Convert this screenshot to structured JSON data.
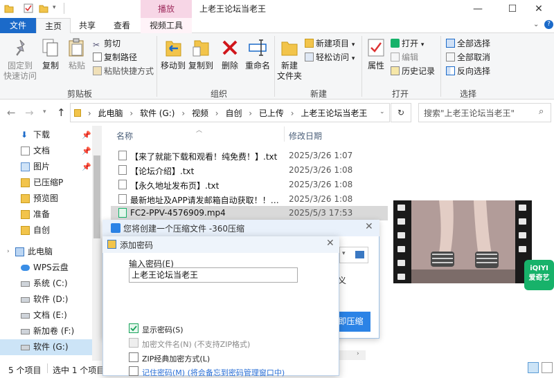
{
  "window": {
    "title": "上老王论坛当老王",
    "contextual_tab_group": "播放",
    "controls": {
      "minimize": "—",
      "maximize": "☐",
      "close": "✕"
    },
    "help": "?"
  },
  "ribbon_tabs": [
    "文件",
    "主页",
    "共享",
    "查看",
    "视频工具"
  ],
  "ribbon": {
    "clipboard": {
      "pin": "固定到\n快速访问",
      "pin_l1": "固定到",
      "pin_l2": "快速访问",
      "copy": "复制",
      "paste": "粘贴",
      "cut": "剪切",
      "copy_path": "复制路径",
      "paste_shortcut": "粘贴快捷方式",
      "label": "剪贴板"
    },
    "organize": {
      "move_to": "移动到",
      "copy_to": "复制到",
      "delete": "删除",
      "rename": "重命名",
      "label": "组织"
    },
    "new": {
      "new_folder_l1": "新建",
      "new_folder_l2": "文件夹",
      "new_item": "新建项目",
      "easy_access": "轻松访问",
      "label": "新建"
    },
    "open": {
      "properties": "属性",
      "open": "打开",
      "edit": "编辑",
      "history": "历史记录",
      "label": "打开"
    },
    "select": {
      "select_all": "全部选择",
      "select_none": "全部取消",
      "invert": "反向选择",
      "label": "选择"
    }
  },
  "address": {
    "crumbs": [
      "此电脑",
      "软件 (G:)",
      "视频",
      "自创",
      "已上传",
      "上老王论坛当老王"
    ],
    "search_placeholder": "搜索\"上老王论坛当老王\""
  },
  "sidebar": {
    "items": [
      {
        "label": "下载",
        "pinned": true
      },
      {
        "label": "文档",
        "pinned": true
      },
      {
        "label": "图片",
        "pinned": true
      },
      {
        "label": "已压缩P",
        "pinned": false
      },
      {
        "label": "预览图",
        "pinned": false
      },
      {
        "label": "准备",
        "pinned": false
      },
      {
        "label": "自创",
        "pinned": false
      },
      {
        "label": "此电脑",
        "pinned": false
      },
      {
        "label": "WPS云盘",
        "pinned": false
      },
      {
        "label": "系统 (C:)",
        "pinned": false
      },
      {
        "label": "软件 (D:)",
        "pinned": false
      },
      {
        "label": "文档 (E:)",
        "pinned": false
      },
      {
        "label": "新加卷 (F:)",
        "pinned": false
      },
      {
        "label": "软件 (G:)",
        "pinned": false
      }
    ]
  },
  "file_list": {
    "columns": {
      "name": "名称",
      "date": "修改日期"
    },
    "rows": [
      {
        "name": "【来了就能下载和观看！纯免费！】.txt",
        "date": "2025/3/26 1:07"
      },
      {
        "name": "【论坛介绍】.txt",
        "date": "2025/3/26 1:08"
      },
      {
        "name": "【永久地址发布页】.txt",
        "date": "2025/3/26 1:08"
      },
      {
        "name": "最新地址及APP请发邮箱自动获取！！！...",
        "date": "2025/3/26 1:08"
      },
      {
        "name": "FC2-PPV-4576909.mp4",
        "date": "2025/5/3 17:53"
      }
    ],
    "selected_index": 4
  },
  "preview": {
    "badge_l1": "iQIYI",
    "badge_l2": "爱奇艺"
  },
  "status": {
    "count": "5 个项目",
    "selected": "选中 1 个项目"
  },
  "dialog_360": {
    "title": "您将创建一个压缩文件 -360压缩",
    "partial_text": "义",
    "button": "即压缩"
  },
  "password_dialog": {
    "title": "添加密码",
    "input_label": "输入密码(E)",
    "input_value": "上老王论坛当老王",
    "show_password": "显示密码(S)",
    "show_password_checked": true,
    "encrypt_names": "加密文件名(N) (不支持ZIP格式)",
    "zip_classic": "ZIP经典加密方式(L)",
    "remember": "记住密码(M) (将会备忘到密码管理窗口中)"
  },
  "colors": {
    "accent": "#1b6ac9",
    "contextual": "#f7d6e6",
    "dialog_button": "#2b83e6",
    "iqiyi": "#17b26a"
  }
}
